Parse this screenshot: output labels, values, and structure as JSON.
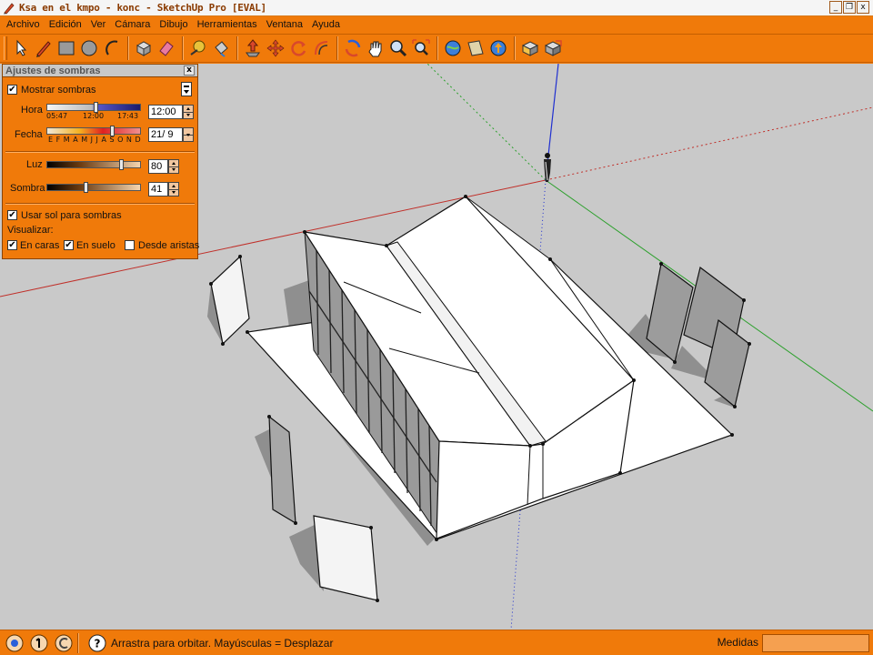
{
  "window": {
    "title": "Ksa en el kmpo - konc - SketchUp Pro [EVAL]",
    "buttons": [
      "_",
      "❐",
      "x"
    ]
  },
  "menu": [
    "Archivo",
    "Edición",
    "Ver",
    "Cámara",
    "Dibujo",
    "Herramientas",
    "Ventana",
    "Ayuda"
  ],
  "toolbar": {
    "tools": [
      "select-icon",
      "pencil-icon",
      "rectangle-icon",
      "circle-icon",
      "arc-icon",
      "make-component-icon",
      "eraser-icon",
      "tape-measure-icon",
      "paint-bucket-icon",
      "push-pull-icon",
      "move-icon",
      "rotate-icon",
      "offset-icon",
      "orbit-icon",
      "pan-icon",
      "zoom-icon",
      "zoom-extents-icon",
      "get-models-icon",
      "share-model-icon",
      "upload-icon",
      "get-photo-icon",
      "component-icon"
    ]
  },
  "shadows_dialog": {
    "title": "Ajustes de sombras",
    "close": "x",
    "show_shadows": {
      "label": "Mostrar sombras",
      "checked": true
    },
    "time": {
      "label": "Hora",
      "value": "12:00",
      "marks": [
        "05:47",
        "12:00",
        "17:43"
      ]
    },
    "date": {
      "label": "Fecha",
      "value": "21/ 9",
      "months": "E F M A M J J A S O N D"
    },
    "light": {
      "label": "Luz",
      "value": "80"
    },
    "dark": {
      "label": "Sombra",
      "value": "41"
    },
    "use_sun": {
      "label": "Usar sol para sombras",
      "checked": true
    },
    "display_label": "Visualizar:",
    "on_faces": {
      "label": "En caras",
      "checked": true
    },
    "on_ground": {
      "label": "En suelo",
      "checked": true
    },
    "from_edges": {
      "label": "Desde aristas",
      "checked": false
    }
  },
  "statusbar": {
    "message": "Arrastra para orbitar. Mayúsculas = Desplazar",
    "measure_label": "Medidas",
    "measure_value": ""
  },
  "colors": {
    "chrome_orange": "#f07a0a",
    "viewport_gray": "#c9c9c9",
    "axis_red": "#c0302a",
    "axis_green": "#2ca02c",
    "axis_blue": "#2030d0"
  }
}
